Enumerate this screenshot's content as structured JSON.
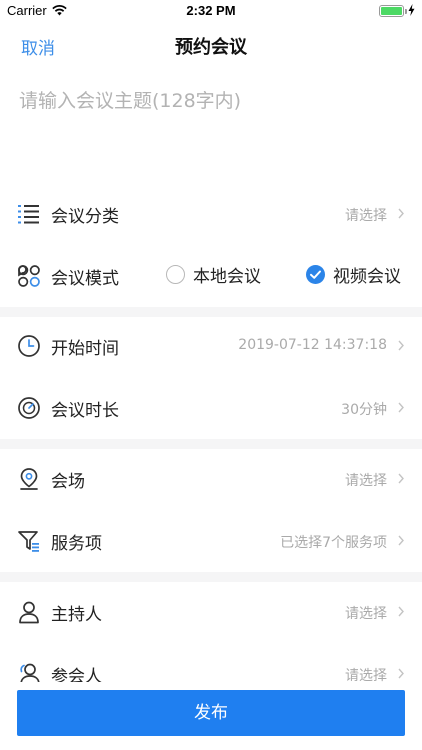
{
  "status_bar": {
    "carrier": "Carrier",
    "time": "2:32 PM"
  },
  "nav": {
    "cancel": "取消",
    "title": "预约会议"
  },
  "topic": {
    "placeholder": "请输入会议主题(128字内)"
  },
  "rows": {
    "category": {
      "label": "会议分类",
      "value": "请选择"
    },
    "mode": {
      "label": "会议模式",
      "options": [
        "本地会议",
        "视频会议"
      ],
      "selected": "视频会议"
    },
    "start_time": {
      "label": "开始时间",
      "value": "2019-07-12 14:37:18"
    },
    "duration": {
      "label": "会议时长",
      "value": "30分钟"
    },
    "venue": {
      "label": "会场",
      "value": "请选择"
    },
    "services": {
      "label": "服务项",
      "value": "已选择7个服务项"
    },
    "host": {
      "label": "主持人",
      "value": "请选择"
    },
    "participants": {
      "label": "参会人",
      "value": "请选择"
    }
  },
  "footer": {
    "publish": "发布"
  },
  "colors": {
    "accent": "#1f7ff0",
    "link": "#3d8ee8",
    "battery": "#4cd964",
    "divider": "#f5f5f6"
  }
}
